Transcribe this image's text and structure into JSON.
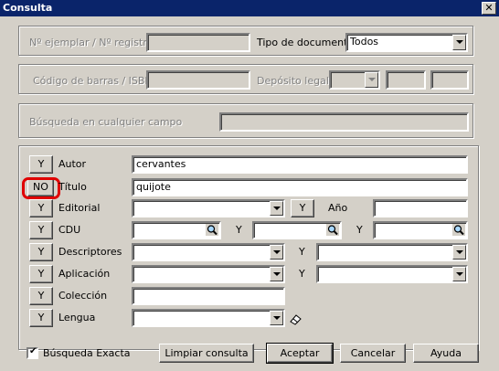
{
  "title": "Consulta",
  "top": {
    "ejemplar_label": "Nº ejemplar / Nº registro",
    "tipo_label": "Tipo de documento",
    "tipo_value": "Todos",
    "codigo_label": "Código de barras / ISBN",
    "deposito_label": "Depósito legal",
    "busqueda_label": "Búsqueda en cualquier campo"
  },
  "criteria": {
    "y": "Y",
    "no": "NO",
    "autor_label": "Autor",
    "autor_value": "cervantes",
    "titulo_label": "Título",
    "titulo_value": "quijote",
    "editorial_label": "Editorial",
    "ano_label": "Año",
    "cdu_label": "CDU",
    "descriptores_label": "Descriptores",
    "aplicacion_label": "Aplicación",
    "coleccion_label": "Colección",
    "lengua_label": "Lengua"
  },
  "bottom": {
    "exacta_label": "Búsqueda Exacta",
    "exacta_checked": true,
    "limpiar": "Limpiar consulta",
    "aceptar": "Aceptar",
    "cancelar": "Cancelar",
    "ayuda": "Ayuda"
  },
  "icons": {
    "close": "close-icon",
    "search": "magnifier-icon",
    "eraser": "eraser-icon"
  }
}
